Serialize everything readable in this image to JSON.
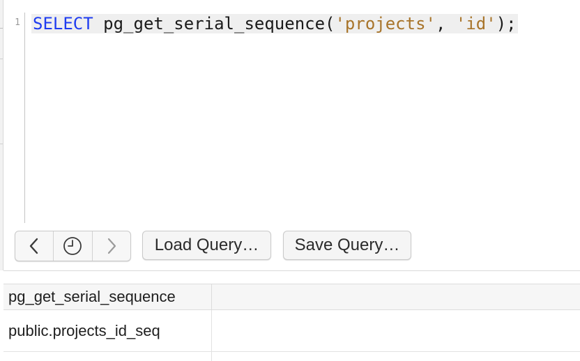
{
  "editor": {
    "line_number": "1",
    "code": {
      "keyword": "SELECT",
      "function_call": " pg_get_serial_sequence(",
      "arg1": "'projects'",
      "separator": ", ",
      "arg2": "'id'",
      "closing": ");"
    }
  },
  "toolbar": {
    "back_icon": "chevron-left-icon",
    "history_icon": "clock-icon",
    "forward_icon": "chevron-right-icon",
    "load_label": "Load Query…",
    "save_label": "Save Query…"
  },
  "results": {
    "columns": [
      "pg_get_serial_sequence"
    ],
    "rows": [
      [
        "public.projects_id_seq"
      ]
    ]
  },
  "colors": {
    "keyword": "#1f3cf0",
    "string": "#a8742a",
    "code_line_highlight": "#efefef"
  }
}
